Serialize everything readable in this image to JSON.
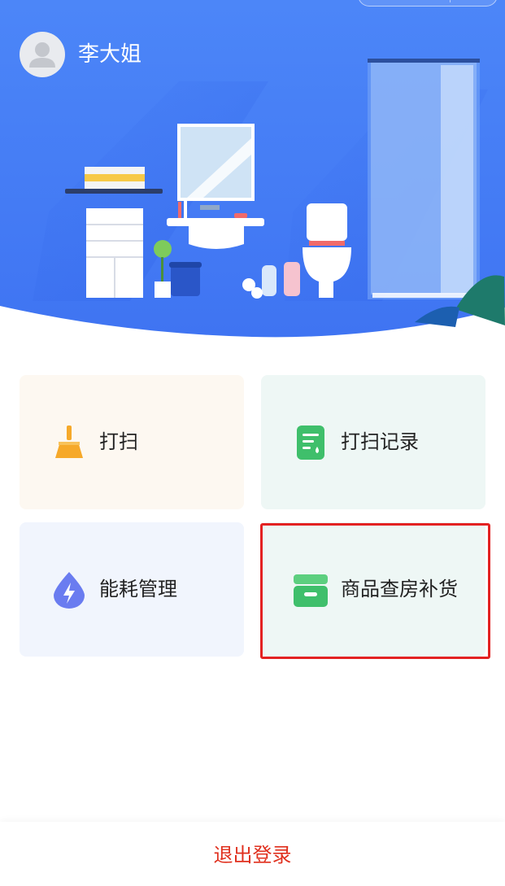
{
  "user": {
    "name": "李大姐",
    "avatar_icon": "user-icon"
  },
  "menu": [
    {
      "label": "打扫",
      "icon": "broom-icon",
      "color": "#f6a92a"
    },
    {
      "label": "打扫记录",
      "icon": "record-doc-icon",
      "color": "#3fbf6b"
    },
    {
      "label": "能耗管理",
      "icon": "energy-drop-icon",
      "color": "#6a7cf0"
    },
    {
      "label": "商品查房补货",
      "icon": "goods-box-icon",
      "color": "#3fbf6b"
    }
  ],
  "footer": {
    "logout_label": "退出登录"
  },
  "colors": {
    "banner": "#4a82f5",
    "logout": "#e0301e",
    "highlight": "#e32222"
  }
}
